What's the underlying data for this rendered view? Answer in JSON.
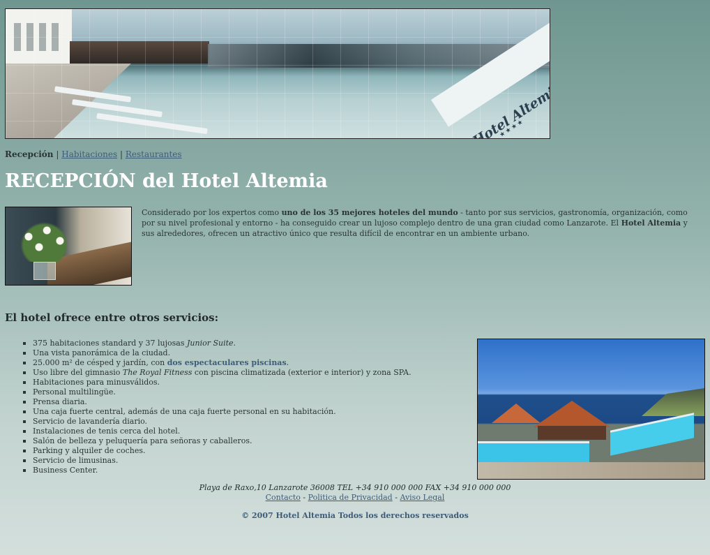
{
  "banner": {
    "logo_text": "Hotel Altemia",
    "logo_stars": "★★★★"
  },
  "nav": {
    "current": "Recepción",
    "separator": "|",
    "links": [
      "Habitaciones",
      "Restaurantes"
    ]
  },
  "page_title": "RECEPCIÓN del Hotel Altemia",
  "intro": {
    "part1": "Considerado por los expertos como ",
    "bold1": "uno de los 35 mejores hoteles del mundo",
    "part2": " - tanto por sus servicios, gastronomía, organización, como por su nivel profesional y entorno - ha conseguido crear un lujoso complejo dentro de una gran ciudad como Lanzarote. El ",
    "bold2": "Hotel Altemia",
    "part3": " y sus alrededores, ofrecen un atractivo único que resulta difícil de encontrar en un ambiente urbano."
  },
  "services_heading": "El hotel ofrece entre otros servicios:",
  "services": {
    "s1_text": "375 habitaciones standard y 37 lujosas ",
    "s1_em": "Junior Suite",
    "s1_end": ".",
    "s2": "Una vista panorámica de la ciudad.",
    "s3_text": "25.000 m² de césped y jardín, con ",
    "s3_hl": "dos espectaculares piscinas",
    "s3_end": ".",
    "s4_text": "Uso libre del gimnasio ",
    "s4_em": "The Royal Fitness",
    "s4_end": " con piscina climatizada (exterior e interior) y zona SPA.",
    "s5": "Habitaciones para minusválidos.",
    "s6": "Personal multilingüe.",
    "s7": "Prensa diaria.",
    "s8": "Una caja fuerte central, además de una caja fuerte personal en su habitación.",
    "s9": "Servicio de lavandería diario.",
    "s10": "Instalaciones de tenis cerca del hotel.",
    "s11": "Salón de belleza y peluquería para señoras y caballeros.",
    "s12": "Parking y alquiler de coches.",
    "s13": "Servicio de limusinas.",
    "s14": "Business Center."
  },
  "footer": {
    "address": "Playa de Raxo,10 Lanzarote 36008 TEL +34 910 000 000 FAX +34 910 000 000",
    "links": [
      "Contacto",
      "Politica de Privacidad",
      "Aviso Legal"
    ],
    "link_separator": " - ",
    "copyright": "© 2007 Hotel Altemia Todos los derechos reservados"
  }
}
